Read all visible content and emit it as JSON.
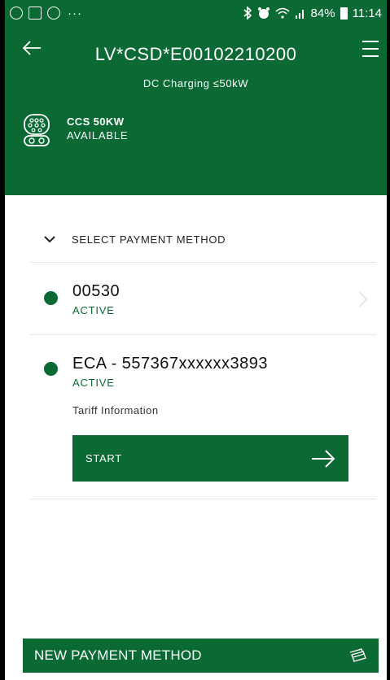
{
  "status_bar": {
    "dots": "···",
    "battery": "84%",
    "time": "11:14"
  },
  "header": {
    "station_id": "LV*CSD*E00102210200",
    "subtitle": "DC Charging ≤50kW",
    "connector": {
      "type": "CCS 50KW",
      "status": "AVAILABLE"
    }
  },
  "payment": {
    "section_label": "SELECT PAYMENT METHOD",
    "methods": [
      {
        "name": "00530",
        "status": "ACTIVE"
      },
      {
        "name": "ECA - 557367xxxxxx3893",
        "status": "ACTIVE",
        "tariff_link": "Tariff Information",
        "start_label": "START"
      }
    ]
  },
  "footer": {
    "new_payment_label": "NEW PAYMENT METHOD"
  },
  "colors": {
    "brand_green": "#0b6a34",
    "background": "#ffffff"
  },
  "icons": [
    "whatsapp-icon",
    "gallery-icon",
    "app-icon",
    "bluetooth-icon",
    "alarm-icon",
    "wifi-icon",
    "signal-icon",
    "battery-icon",
    "back-arrow-icon",
    "hamburger-menu-icon",
    "ccs-connector-icon",
    "chevron-down-icon",
    "chevron-right-icon",
    "arrow-right-icon",
    "card-icon"
  ]
}
